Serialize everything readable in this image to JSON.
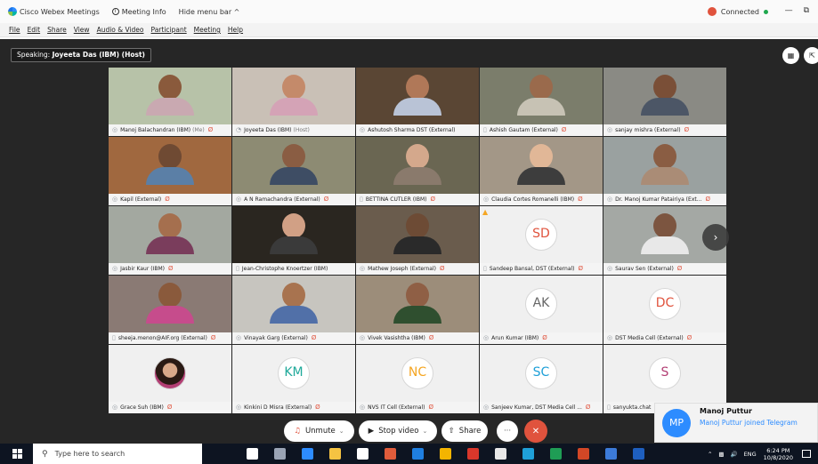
{
  "titlebar": {
    "app_name": "Cisco Webex Meetings",
    "meeting_info": "Meeting Info",
    "hide_menu": "Hide menu bar ^",
    "status": "Connected",
    "minimize": "—",
    "restore": "⧉"
  },
  "menu": [
    "File",
    "Edit",
    "Share",
    "View",
    "Audio & Video",
    "Participant",
    "Meeting",
    "Help"
  ],
  "speaking": {
    "label": "Speaking:",
    "name": "Joyeeta Das (IBM) (Host)"
  },
  "participants": [
    {
      "name": "Manoj Balachandran (IBM)",
      "role": "(Me)",
      "mic": "on",
      "muted": true,
      "tile": "video",
      "bg": "#b7c2a8",
      "skin": "#8a5a3c",
      "shirt": "#c9a9b1"
    },
    {
      "name": "Joyeeta Das (IBM)",
      "role": "(Host)",
      "mic": "speaking",
      "muted": false,
      "tile": "video",
      "bg": "#c9c0b6",
      "skin": "#c48a6a",
      "shirt": "#d4a3b6"
    },
    {
      "name": "Ashutosh Sharma DST (External)",
      "role": "",
      "mic": "on",
      "muted": false,
      "tile": "video",
      "bg": "#5a4634",
      "skin": "#b07858",
      "shirt": "#b9c3d6"
    },
    {
      "name": "Ashish Gautam (External)",
      "role": "",
      "mic": "phone",
      "muted": true,
      "tile": "video",
      "bg": "#7b7d6b",
      "skin": "#9a6a4c",
      "shirt": "#c7c2b4"
    },
    {
      "name": "sanjay mishra (External)",
      "role": "",
      "mic": "on",
      "muted": true,
      "tile": "video",
      "bg": "#8a8a84",
      "skin": "#7a4f37",
      "shirt": "#4c5666"
    },
    {
      "name": "Kapil (External)",
      "role": "",
      "mic": "on",
      "muted": true,
      "tile": "video",
      "bg": "#a0683f",
      "skin": "#6f4a33",
      "shirt": "#5b7fa6"
    },
    {
      "name": "A N Ramachandra (External)",
      "role": "",
      "mic": "on",
      "muted": true,
      "tile": "video",
      "bg": "#8d8b73",
      "skin": "#8a5d43",
      "shirt": "#3e4d64"
    },
    {
      "name": "BETTINA CUTLER (IBM)",
      "role": "",
      "mic": "phone",
      "muted": true,
      "tile": "video",
      "bg": "#6a6652",
      "skin": "#d4a88c",
      "shirt": "#8a7a6c"
    },
    {
      "name": "Claudia Cortes Romanelli (IBM)",
      "role": "",
      "mic": "on",
      "muted": true,
      "tile": "video",
      "bg": "#a39787",
      "skin": "#e1b797",
      "shirt": "#3d3d3d"
    },
    {
      "name": "Dr. Manoj Kumar Patairiya (Ext...",
      "role": "",
      "mic": "on",
      "muted": true,
      "tile": "video",
      "bg": "#9aa1a0",
      "skin": "#8a5d43",
      "shirt": "#aa8c76"
    },
    {
      "name": "Jasbir Kaur (IBM)",
      "role": "",
      "mic": "on",
      "muted": true,
      "tile": "video",
      "bg": "#a3a8a0",
      "skin": "#a56f4e",
      "shirt": "#7a3d5c"
    },
    {
      "name": "Jean-Christophe Knoertzer (IBM)",
      "role": "",
      "mic": "phone",
      "muted": false,
      "tile": "video",
      "bg": "#2a2620",
      "skin": "#d1a085",
      "shirt": "#3a3a3a"
    },
    {
      "name": "Mathew Joseph (External)",
      "role": "",
      "mic": "on",
      "muted": true,
      "tile": "video",
      "bg": "#6a5c4d",
      "skin": "#6d4b35",
      "shirt": "#2a2a2a"
    },
    {
      "name": "Sandeep Bansal, DST (External)",
      "role": "",
      "mic": "phone",
      "muted": true,
      "tile": "avatar",
      "initials": "SD",
      "color": "#e0533d",
      "warning": true
    },
    {
      "name": "Saurav Sen (External)",
      "role": "",
      "mic": "on",
      "muted": true,
      "tile": "video",
      "bg": "#a4a8a4",
      "skin": "#7c5540",
      "shirt": "#e8e8e8"
    },
    {
      "name": "sheeja.menon@AIF.org (External)",
      "role": "",
      "mic": "phone",
      "muted": true,
      "tile": "video",
      "bg": "#8a7a74",
      "skin": "#8a5a3c",
      "shirt": "#c64c8c"
    },
    {
      "name": "Vinayak Garg (External)",
      "role": "",
      "mic": "on",
      "muted": true,
      "tile": "video",
      "bg": "#c7c5bf",
      "skin": "#a8734f",
      "shirt": "#5170a8"
    },
    {
      "name": "Vivek Vasishtha (IBM)",
      "role": "",
      "mic": "on",
      "muted": true,
      "tile": "video",
      "bg": "#9c8d7a",
      "skin": "#8f5f45",
      "shirt": "#2f4f2f"
    },
    {
      "name": "Arun Kumar (IBM)",
      "role": "",
      "mic": "on",
      "muted": true,
      "tile": "avatar",
      "initials": "AK",
      "color": "#666666"
    },
    {
      "name": "DST Media Cell (External)",
      "role": "",
      "mic": "on",
      "muted": true,
      "tile": "avatar",
      "initials": "DC",
      "color": "#e0533d"
    },
    {
      "name": "Grace Suh (IBM)",
      "role": "",
      "mic": "on",
      "muted": true,
      "tile": "photo",
      "color": "#b33f74"
    },
    {
      "name": "Kinkini D Misra (External)",
      "role": "",
      "mic": "on",
      "muted": true,
      "tile": "avatar",
      "initials": "KM",
      "color": "#1fa99a"
    },
    {
      "name": "NVS IT Cell (External)",
      "role": "",
      "mic": "on",
      "muted": true,
      "tile": "avatar",
      "initials": "NC",
      "color": "#f5a623"
    },
    {
      "name": "Sanjeev Kumar, DST Media Cell ...",
      "role": "",
      "mic": "on",
      "muted": true,
      "tile": "avatar",
      "initials": "SC",
      "color": "#1fa0d8"
    },
    {
      "name": "sanyukta.chat",
      "role": "",
      "mic": "phone",
      "muted": false,
      "tile": "avatar",
      "initials": "S",
      "color": "#b33f74"
    }
  ],
  "controls": {
    "unmute": "Unmute",
    "stop_video": "Stop video",
    "share": "Share",
    "more": "···",
    "leave": "✕"
  },
  "toast": {
    "initials": "MP",
    "name": "Manoj Puttur",
    "message": "Manoj Puttur joined Telegram"
  },
  "taskbar": {
    "search_placeholder": "Type here to search",
    "tray_lang": "ENG",
    "time": "6:24 PM",
    "date": "10/8/2020",
    "pinned": [
      {
        "name": "cortana-icon",
        "color": "#ffffff"
      },
      {
        "name": "task-view-icon",
        "color": "#9aa4b5"
      },
      {
        "name": "edge-icon",
        "color": "#2d8cff"
      },
      {
        "name": "file-explorer-icon",
        "color": "#f5c342"
      },
      {
        "name": "store-icon",
        "color": "#ffffff"
      },
      {
        "name": "media-player-icon",
        "color": "#e05c3b"
      },
      {
        "name": "mail-icon",
        "color": "#1f7fe0"
      },
      {
        "name": "chrome-icon",
        "color": "#f4b400"
      },
      {
        "name": "acrobat-icon",
        "color": "#d9372b"
      },
      {
        "name": "app-icon",
        "color": "#e8e8e8"
      },
      {
        "name": "webex-icon",
        "color": "#1fa0d8"
      },
      {
        "name": "excel-icon",
        "color": "#1f9d55"
      },
      {
        "name": "powerpoint-icon",
        "color": "#d24726"
      },
      {
        "name": "photos-icon",
        "color": "#3c7bd9"
      },
      {
        "name": "browser-icon",
        "color": "#1e5fbf"
      }
    ]
  }
}
